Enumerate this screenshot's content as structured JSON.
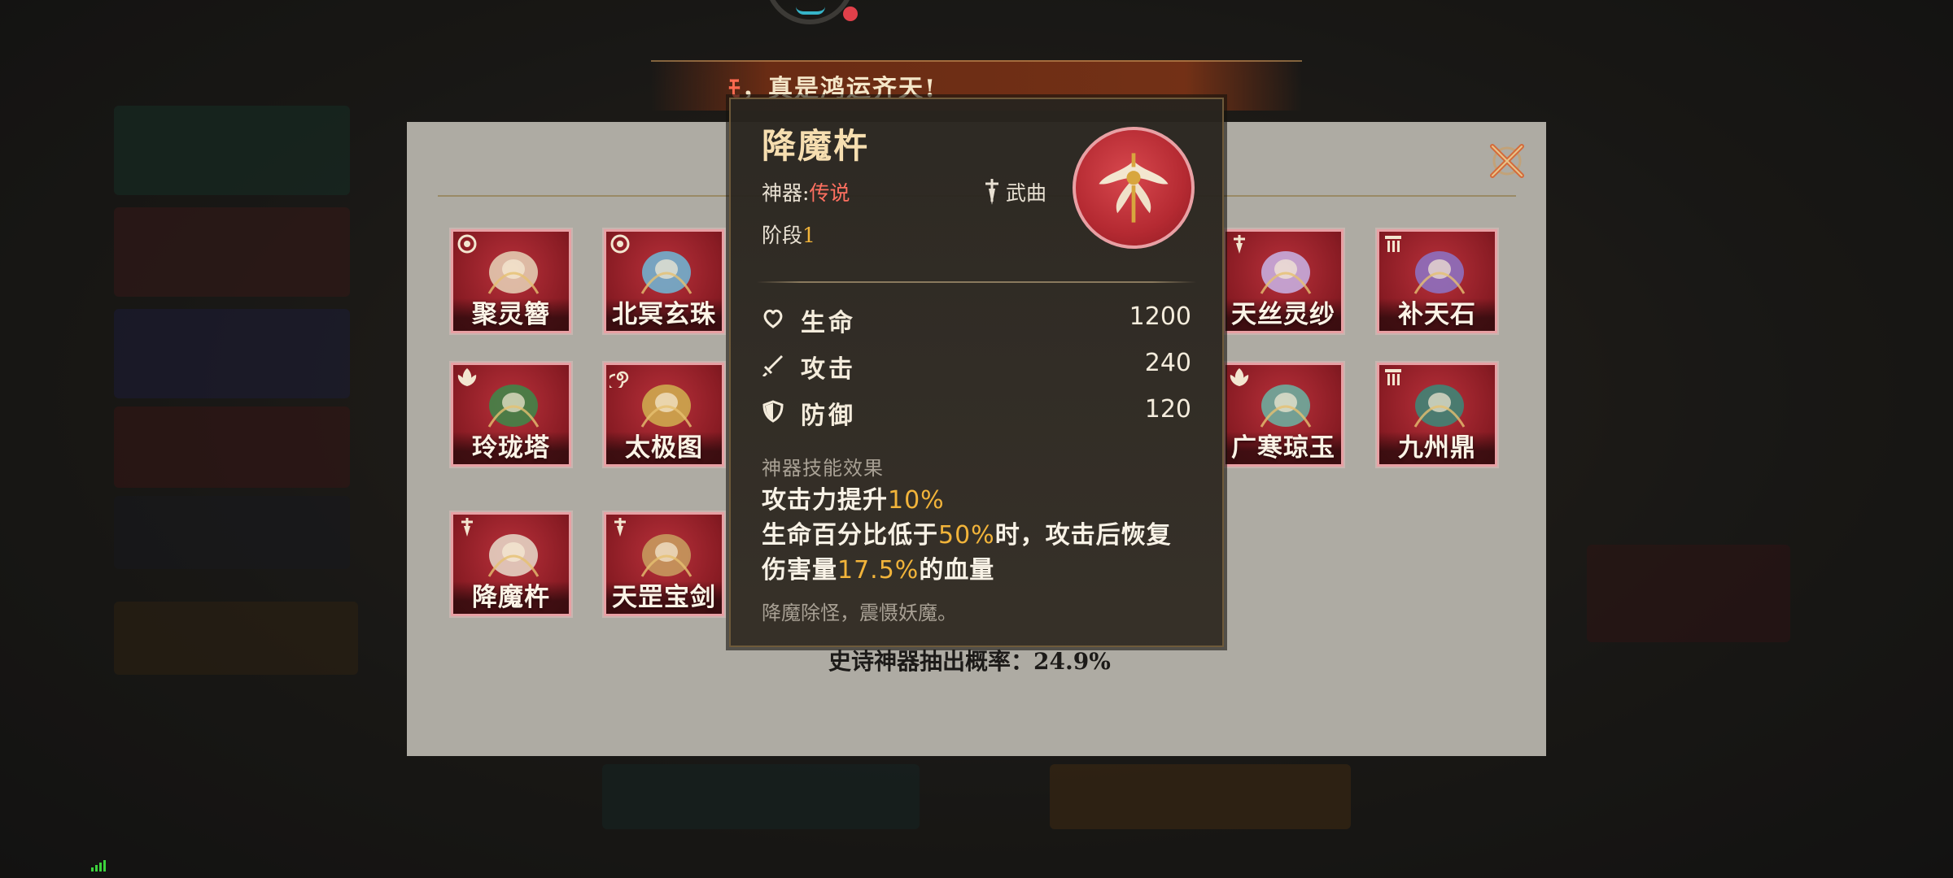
{
  "banner": {
    "prefix": "&",
    "text": "，真是鸿运齐天!"
  },
  "artifacts": [
    {
      "name": "聚灵簪",
      "tag": "wheel"
    },
    {
      "name": "北冥玄珠",
      "tag": "wheel"
    },
    {
      "name": "天丝灵纱",
      "tag": "sword"
    },
    {
      "name": "补天石",
      "tag": "tower"
    },
    {
      "name": "玲珑塔",
      "tag": "leaf"
    },
    {
      "name": "太极图",
      "tag": "spiral"
    },
    {
      "name": "广寒琼玉",
      "tag": "leaf"
    },
    {
      "name": "九州鼎",
      "tag": "tower"
    },
    {
      "name": "降魔杵",
      "tag": "sword"
    },
    {
      "name": "天罡宝剑",
      "tag": "sword"
    }
  ],
  "draw_rate": "史诗神器抽出概率：24.9%",
  "detail": {
    "name": "降魔杵",
    "rarity_label": "神器:",
    "rarity_value": "传说",
    "class_name": "武曲",
    "stage_label": "阶段",
    "stage_value": "1",
    "stats": [
      {
        "name": "生命",
        "value": "1200",
        "icon": "heart-icon"
      },
      {
        "name": "攻击",
        "value": "240",
        "icon": "sword-icon"
      },
      {
        "name": "防御",
        "value": "120",
        "icon": "shield-icon"
      }
    ],
    "skill_header": "神器技能效果",
    "skill_line1_a": "攻击力提升",
    "skill_line1_hl": "10%",
    "skill_line2_a": "生命百分比低于",
    "skill_line2_hl": "50%",
    "skill_line2_b": "时，攻击后恢复",
    "skill_line3_a": "伤害量",
    "skill_line3_hl": "17.5%",
    "skill_line3_b": "的血量",
    "flavor": "降魔除怪，震慑妖魔。"
  },
  "colors": {
    "rarity_legend": "#ff7060",
    "highlight": "#f2b43a",
    "card_red": "#a82630"
  }
}
